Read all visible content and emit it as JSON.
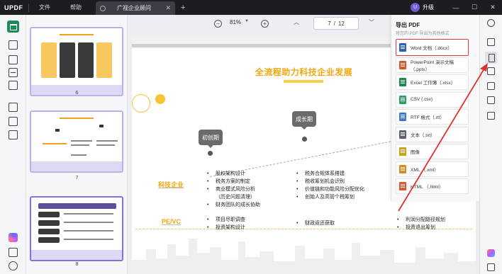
{
  "app": {
    "logo": "UPDF"
  },
  "menu": {
    "file": "文件",
    "help": "帮助"
  },
  "tab": {
    "title": "广视企业顾问",
    "close": "✕",
    "new": "+"
  },
  "account": {
    "avatar": "U",
    "upgrade": "升级"
  },
  "window": {
    "minimize": "—",
    "maximize": "☐",
    "close": "✕"
  },
  "toolbar": {
    "zoom_out": "−",
    "zoom_value": "81%",
    "zoom_caret": "▼",
    "zoom_in": "+",
    "page_up": "︿",
    "page_current": "7",
    "page_sep": "/",
    "page_total": "12",
    "page_down": "﹀"
  },
  "thumbnails": [
    {
      "num": "6"
    },
    {
      "num": "7"
    },
    {
      "num": "8"
    }
  ],
  "page": {
    "title": "全流程助力科技企业发展",
    "stage1": "初创期",
    "stage2": "成长期",
    "row1_label": "科技企业",
    "row2_label": "PE/VC",
    "col1": [
      "股权架构设计",
      "税务方案的制定",
      "商业模式风险分析",
      "（历史问题清理）",
      "财务团队的成长协助"
    ],
    "col2": [
      "税务合规体系搭建",
      "税收筹划机会识别",
      "价值链和功能风险分配优化",
      "创始人及高管个税筹划"
    ],
    "pe_col1": [
      "项目尽职调查",
      "投资架构设计"
    ],
    "pe_col2": [
      "财政返还获取"
    ],
    "pe_col3": [
      "利润分配路径规划",
      "投资退出筹划"
    ],
    "number": "7"
  },
  "export": {
    "title": "导出 PDF",
    "subtitle": "将您的 PDF 导出为其他格式",
    "items": [
      {
        "label": "Word 文档（.docx）",
        "color": "#2b5fb8"
      },
      {
        "label": "PowerPoint 演示文稿（.pptx）",
        "color": "#d9582b"
      },
      {
        "label": "Excel 工作簿（.xlsx）",
        "color": "#1f8a4c"
      },
      {
        "label": "CSV (.csv)",
        "color": "#2e9e6a"
      },
      {
        "label": "RTF 格式（.rtf）",
        "color": "#3b7bd6"
      },
      {
        "label": "文本（.txt）",
        "color": "#5b6270"
      },
      {
        "label": "图像",
        "color": "#c9a21f"
      },
      {
        "label": "XML （.xml）",
        "color": "#d98a1f"
      },
      {
        "label": "HTML （.html）",
        "color": "#e0572b"
      }
    ]
  },
  "colors": {
    "accent": "#f5a60f",
    "highlight": "#e2373b",
    "brand": "#1f8a5b"
  }
}
